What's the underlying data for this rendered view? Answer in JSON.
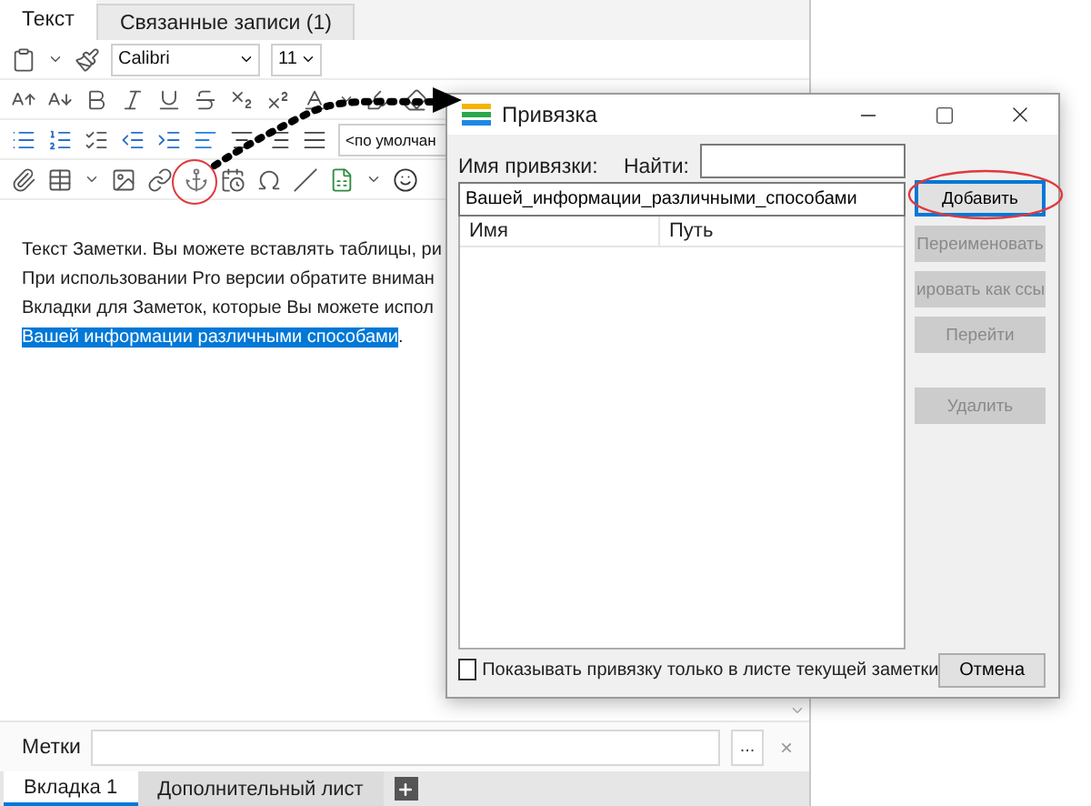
{
  "editor": {
    "tabs": [
      {
        "label": "Текст",
        "selected": true
      },
      {
        "label": "Связанные записи  (1)",
        "selected": false
      }
    ],
    "font": "Calibri",
    "font_size": "11",
    "paragraph_style": "<по умолчан",
    "alignment_buttons": [
      {
        "selected": true
      },
      {
        "selected": false
      },
      {
        "selected": false
      },
      {
        "selected": false
      }
    ],
    "text_lines": [
      [
        {
          "text": "Текст Заметки. Вы можете вставлять таблицы, ри",
          "selected": false
        }
      ],
      [
        {
          "text": "При использовании Pro версии обратите вниман",
          "selected": false
        }
      ],
      [
        {
          "text": "Вкладки для Заметок, которые Вы можете испол",
          "selected": false
        }
      ],
      [
        {
          "text": "Вашей информации различными способами",
          "selected": true
        },
        {
          "text": ".",
          "selected": false
        }
      ]
    ],
    "tags_label": "Метки",
    "tags_button": "...",
    "tags_clear": "×",
    "sheet_tabs": [
      {
        "label": "Вкладка 1",
        "selected": true
      },
      {
        "label": "Дополнительный лист",
        "selected": false
      }
    ]
  },
  "dialog": {
    "title": "Привязка",
    "name_label": "Имя привязки:",
    "find_label": "Найти:",
    "name_value": "Вашей_информации_различными_способами",
    "columns": [
      "Имя",
      "Путь"
    ],
    "buttons": [
      {
        "label": "Добавить",
        "disabled": false
      },
      {
        "label": "Переименовать",
        "disabled": true
      },
      {
        "label": "ировать как ссы",
        "disabled": true
      },
      {
        "label": "Перейти",
        "disabled": true
      },
      {
        "label": "Удалить",
        "disabled": true
      }
    ],
    "checkbox": {
      "label": "Показывать привязку только в листе текущей заметки",
      "checked": false
    },
    "cancel": "Отмена"
  }
}
